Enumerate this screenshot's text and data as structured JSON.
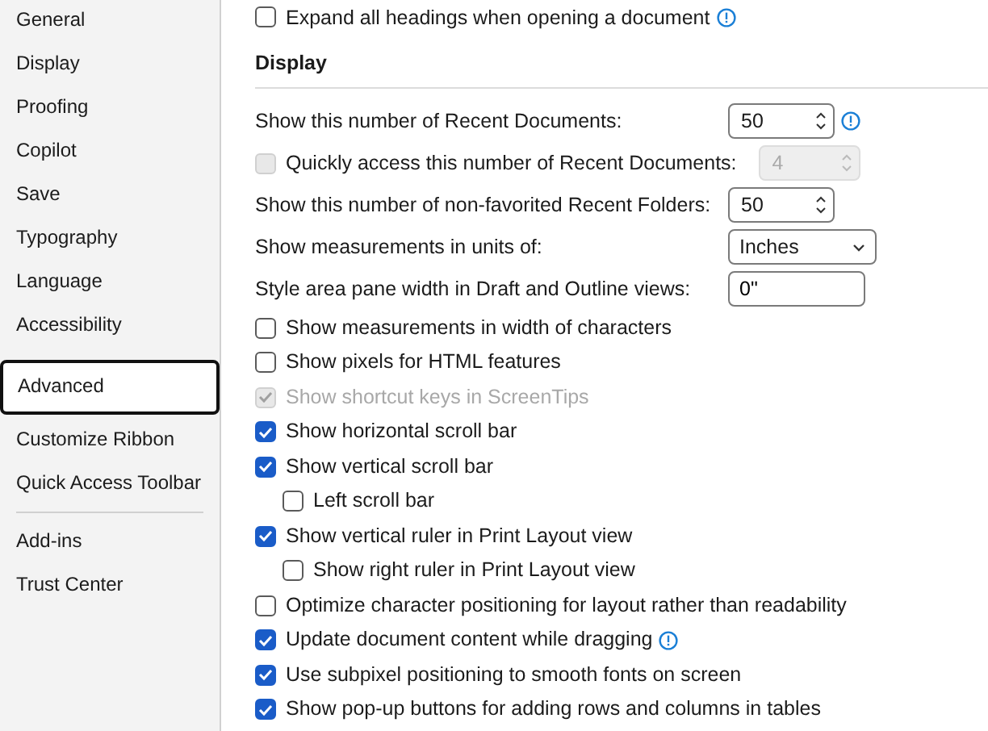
{
  "sidebar": {
    "items": [
      {
        "label": "General",
        "selected": false,
        "divider_after": false
      },
      {
        "label": "Display",
        "selected": false,
        "divider_after": false
      },
      {
        "label": "Proofing",
        "selected": false,
        "divider_after": false
      },
      {
        "label": "Copilot",
        "selected": false,
        "divider_after": false
      },
      {
        "label": "Save",
        "selected": false,
        "divider_after": false
      },
      {
        "label": "Typography",
        "selected": false,
        "divider_after": false
      },
      {
        "label": "Language",
        "selected": false,
        "divider_after": false
      },
      {
        "label": "Accessibility",
        "selected": false,
        "divider_after": false
      },
      {
        "label": "Advanced",
        "selected": true,
        "divider_after": false
      },
      {
        "label": "Customize Ribbon",
        "selected": false,
        "divider_after": false
      },
      {
        "label": "Quick Access Toolbar",
        "selected": false,
        "divider_after": true
      },
      {
        "label": "Add-ins",
        "selected": false,
        "divider_after": false
      },
      {
        "label": "Trust Center",
        "selected": false,
        "divider_after": false
      }
    ]
  },
  "previous_option": {
    "label": "Expand all headings when opening a document",
    "checked": false,
    "info": true
  },
  "display": {
    "heading": "Display",
    "options": [
      {
        "kind": "spin",
        "label": "Show this number of Recent Documents:",
        "value": "50",
        "info": true
      },
      {
        "kind": "checkbox-spin",
        "label": "Quickly access this number of Recent Documents:",
        "value": "4",
        "checked": false,
        "disabled": true,
        "info": false
      },
      {
        "kind": "spin",
        "label": "Show this number of non-favorited Recent Folders:",
        "value": "50",
        "info": false
      },
      {
        "kind": "select",
        "label": "Show measurements in units of:",
        "value": "Inches",
        "info": false
      },
      {
        "kind": "text",
        "label": "Style area pane width in Draft and Outline views:",
        "value": "0\"",
        "info": false
      },
      {
        "kind": "checkbox",
        "label": "Show measurements in width of characters",
        "checked": false,
        "disabled": false,
        "info": false
      },
      {
        "kind": "checkbox",
        "label": "Show pixels for HTML features",
        "checked": false,
        "disabled": false,
        "info": false
      },
      {
        "kind": "checkbox",
        "label": "Show shortcut keys in ScreenTips",
        "checked": true,
        "disabled": true,
        "info": false
      },
      {
        "kind": "checkbox",
        "label": "Show horizontal scroll bar",
        "checked": true,
        "disabled": false,
        "info": false
      },
      {
        "kind": "checkbox",
        "label": "Show vertical scroll bar",
        "checked": true,
        "disabled": false,
        "info": false,
        "children": [
          {
            "kind": "checkbox",
            "label": "Left scroll bar",
            "checked": false,
            "disabled": false,
            "info": false
          }
        ]
      },
      {
        "kind": "checkbox",
        "label": "Show vertical ruler in Print Layout view",
        "checked": true,
        "disabled": false,
        "info": false,
        "children": [
          {
            "kind": "checkbox",
            "label": "Show right ruler in Print Layout view",
            "checked": false,
            "disabled": false,
            "info": false
          }
        ]
      },
      {
        "kind": "checkbox",
        "label": "Optimize character positioning for layout rather than readability",
        "checked": false,
        "disabled": false,
        "info": false
      },
      {
        "kind": "checkbox",
        "label": "Update document content while dragging",
        "checked": true,
        "disabled": false,
        "info": true
      },
      {
        "kind": "checkbox",
        "label": "Use subpixel positioning to smooth fonts on screen",
        "checked": true,
        "disabled": false,
        "info": false
      },
      {
        "kind": "checkbox",
        "label": "Show pop-up buttons for adding rows and columns in tables",
        "checked": true,
        "disabled": false,
        "info": false
      }
    ]
  }
}
